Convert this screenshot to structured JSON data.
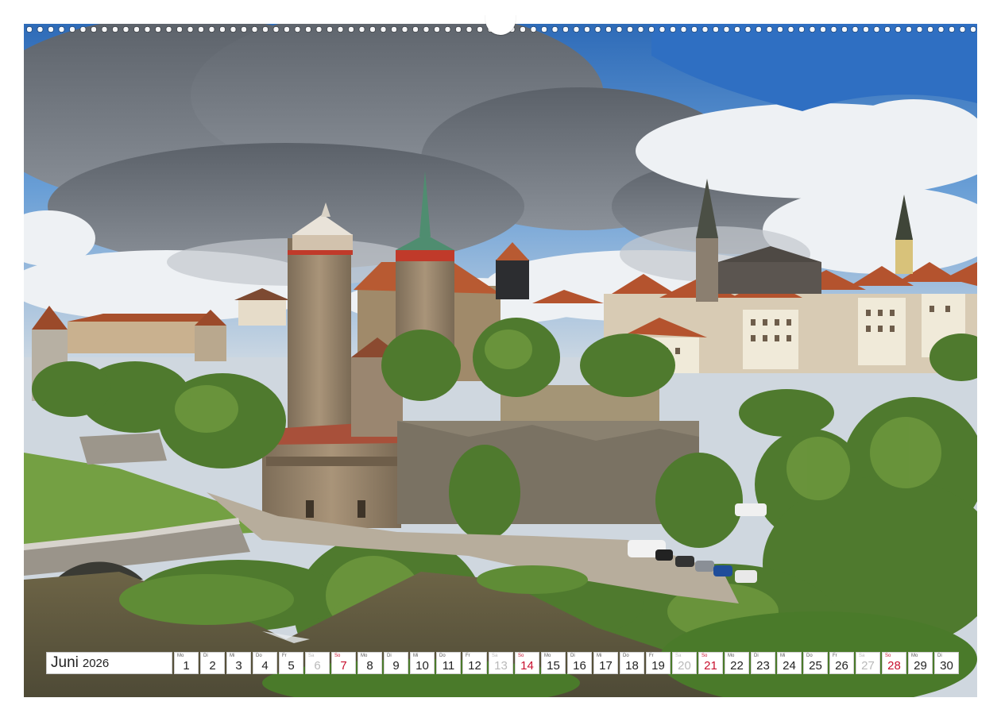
{
  "calendar": {
    "month": "Juni",
    "year": "2026",
    "weekend_color": "#c8102e",
    "saturday_color": "#b9b9b9",
    "days": [
      {
        "wd": "Mo",
        "num": "1",
        "type": "week"
      },
      {
        "wd": "Di",
        "num": "2",
        "type": "week"
      },
      {
        "wd": "Mi",
        "num": "3",
        "type": "week"
      },
      {
        "wd": "Do",
        "num": "4",
        "type": "week"
      },
      {
        "wd": "Fr",
        "num": "5",
        "type": "week"
      },
      {
        "wd": "Sa",
        "num": "6",
        "type": "sat"
      },
      {
        "wd": "So",
        "num": "7",
        "type": "sun"
      },
      {
        "wd": "Mo",
        "num": "8",
        "type": "week"
      },
      {
        "wd": "Di",
        "num": "9",
        "type": "week"
      },
      {
        "wd": "Mi",
        "num": "10",
        "type": "week"
      },
      {
        "wd": "Do",
        "num": "11",
        "type": "week"
      },
      {
        "wd": "Fr",
        "num": "12",
        "type": "week"
      },
      {
        "wd": "Sa",
        "num": "13",
        "type": "sat"
      },
      {
        "wd": "So",
        "num": "14",
        "type": "sun"
      },
      {
        "wd": "Mo",
        "num": "15",
        "type": "week"
      },
      {
        "wd": "Di",
        "num": "16",
        "type": "week"
      },
      {
        "wd": "Mi",
        "num": "17",
        "type": "week"
      },
      {
        "wd": "Do",
        "num": "18",
        "type": "week"
      },
      {
        "wd": "Fr",
        "num": "19",
        "type": "week"
      },
      {
        "wd": "Sa",
        "num": "20",
        "type": "sat"
      },
      {
        "wd": "So",
        "num": "21",
        "type": "sun"
      },
      {
        "wd": "Mo",
        "num": "22",
        "type": "week"
      },
      {
        "wd": "Di",
        "num": "23",
        "type": "week"
      },
      {
        "wd": "Mi",
        "num": "24",
        "type": "week"
      },
      {
        "wd": "Do",
        "num": "25",
        "type": "week"
      },
      {
        "wd": "Fr",
        "num": "26",
        "type": "week"
      },
      {
        "wd": "Sa",
        "num": "27",
        "type": "sat"
      },
      {
        "wd": "So",
        "num": "28",
        "type": "sun"
      },
      {
        "wd": "Mo",
        "num": "29",
        "type": "week"
      },
      {
        "wd": "Di",
        "num": "30",
        "type": "week"
      }
    ]
  },
  "photo": {
    "subject": "bautzen-old-town-panorama",
    "colors": {
      "sky": "#3f7fc9",
      "cloud_dark": "#6f7680",
      "cloud_light": "#eef1f4",
      "stone": "#9c8a72",
      "roof": "#b4532e",
      "greenery": "#4f7a2e",
      "river": "#5b5640"
    }
  }
}
